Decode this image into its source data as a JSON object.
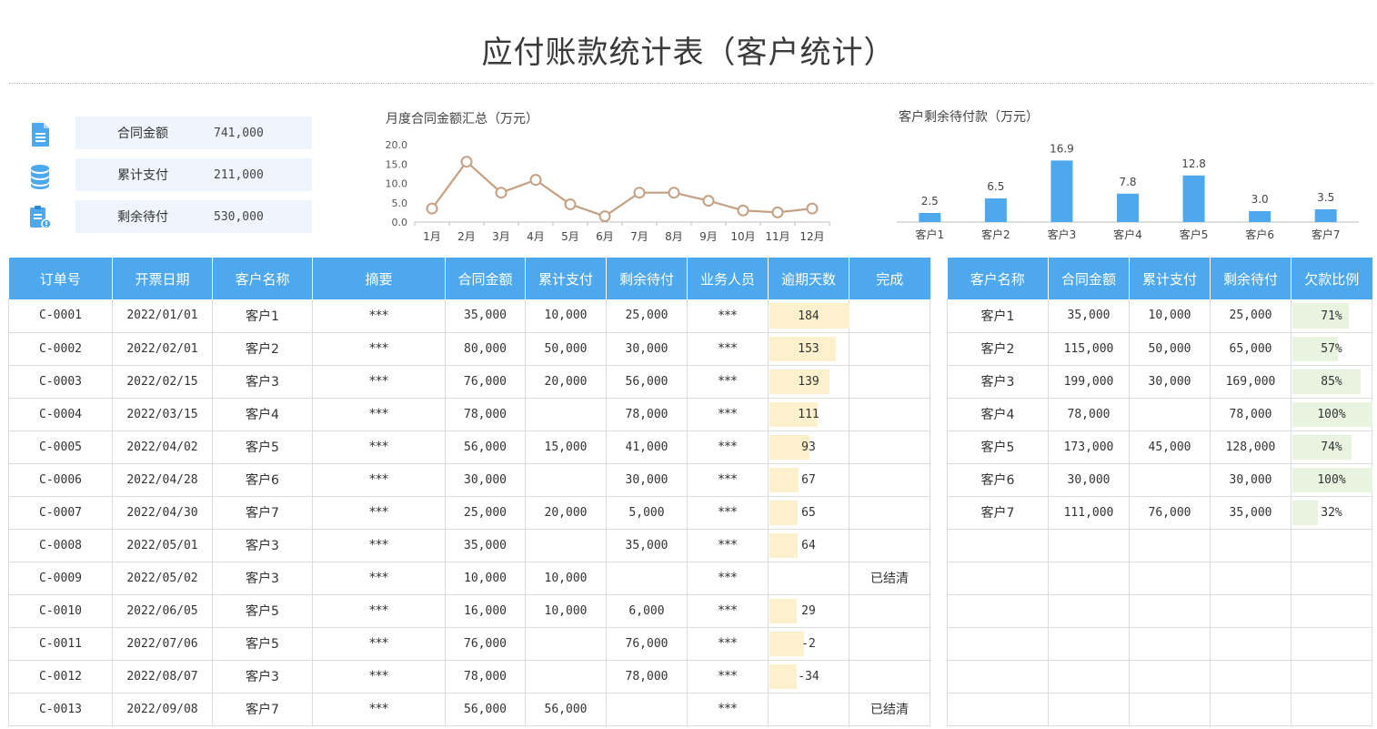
{
  "title": "应付账款统计表（客户统计）",
  "summary": [
    {
      "label": "合同金额",
      "value": "741,000",
      "icon": "document-icon"
    },
    {
      "label": "累计支付",
      "value": "211,000",
      "icon": "database-icon"
    },
    {
      "label": "剩余待付",
      "value": "530,000",
      "icon": "clipboard-alert-icon"
    }
  ],
  "chart_data": [
    {
      "type": "line",
      "title": "月度合同金额汇总（万元）",
      "categories": [
        "1月",
        "2月",
        "3月",
        "4月",
        "5月",
        "6月",
        "7月",
        "8月",
        "9月",
        "10月",
        "11月",
        "12月"
      ],
      "values": [
        3.5,
        15.6,
        7.6,
        10.9,
        4.6,
        1.5,
        7.6,
        7.6,
        5.5,
        3.0,
        2.5,
        3.5
      ],
      "ylim": [
        0,
        20
      ],
      "yticks": [
        "0.0",
        "5.0",
        "10.0",
        "15.0",
        "20.0"
      ],
      "color": "#c4a184",
      "grid": false
    },
    {
      "type": "bar",
      "title": "客户剩余待付款（万元）",
      "categories": [
        "客户1",
        "客户2",
        "客户3",
        "客户4",
        "客户5",
        "客户6",
        "客户7"
      ],
      "values": [
        2.5,
        6.5,
        16.9,
        7.8,
        12.8,
        3.0,
        3.5
      ],
      "labels": [
        "2.5",
        "6.5",
        "16.9",
        "7.8",
        "12.8",
        "3.0",
        "3.5"
      ],
      "ylim": [
        0,
        17
      ],
      "color": "#4ea8ee",
      "grid": false
    }
  ],
  "orders": {
    "headers": [
      "订单号",
      "开票日期",
      "客户名称",
      "摘要",
      "合同金额",
      "累计支付",
      "剩余待付",
      "业务人员",
      "逾期天数",
      "完成"
    ],
    "overdue_max": 184,
    "rows": [
      {
        "id": "C-0001",
        "date": "2022/01/01",
        "customer": "客户1",
        "summary": "***",
        "amount": "35,000",
        "paid": "10,000",
        "remaining": "25,000",
        "staff": "***",
        "overdue": 184,
        "done": ""
      },
      {
        "id": "C-0002",
        "date": "2022/02/01",
        "customer": "客户2",
        "summary": "***",
        "amount": "80,000",
        "paid": "50,000",
        "remaining": "30,000",
        "staff": "***",
        "overdue": 153,
        "done": ""
      },
      {
        "id": "C-0003",
        "date": "2022/02/15",
        "customer": "客户3",
        "summary": "***",
        "amount": "76,000",
        "paid": "20,000",
        "remaining": "56,000",
        "staff": "***",
        "overdue": 139,
        "done": ""
      },
      {
        "id": "C-0004",
        "date": "2022/03/15",
        "customer": "客户4",
        "summary": "***",
        "amount": "78,000",
        "paid": "",
        "remaining": "78,000",
        "staff": "***",
        "overdue": 111,
        "done": ""
      },
      {
        "id": "C-0005",
        "date": "2022/04/02",
        "customer": "客户5",
        "summary": "***",
        "amount": "56,000",
        "paid": "15,000",
        "remaining": "41,000",
        "staff": "***",
        "overdue": 93,
        "done": ""
      },
      {
        "id": "C-0006",
        "date": "2022/04/28",
        "customer": "客户6",
        "summary": "***",
        "amount": "30,000",
        "paid": "",
        "remaining": "30,000",
        "staff": "***",
        "overdue": 67,
        "done": ""
      },
      {
        "id": "C-0007",
        "date": "2022/04/30",
        "customer": "客户7",
        "summary": "***",
        "amount": "25,000",
        "paid": "20,000",
        "remaining": "5,000",
        "staff": "***",
        "overdue": 65,
        "done": ""
      },
      {
        "id": "C-0008",
        "date": "2022/05/01",
        "customer": "客户3",
        "summary": "***",
        "amount": "35,000",
        "paid": "",
        "remaining": "35,000",
        "staff": "***",
        "overdue": 64,
        "done": ""
      },
      {
        "id": "C-0009",
        "date": "2022/05/02",
        "customer": "客户3",
        "summary": "***",
        "amount": "10,000",
        "paid": "10,000",
        "remaining": "",
        "staff": "***",
        "overdue": null,
        "done": "已结清"
      },
      {
        "id": "C-0010",
        "date": "2022/06/05",
        "customer": "客户5",
        "summary": "***",
        "amount": "16,000",
        "paid": "10,000",
        "remaining": "6,000",
        "staff": "***",
        "overdue": 29,
        "done": ""
      },
      {
        "id": "C-0011",
        "date": "2022/07/06",
        "customer": "客户5",
        "summary": "***",
        "amount": "76,000",
        "paid": "",
        "remaining": "76,000",
        "staff": "***",
        "overdue": -2,
        "done": ""
      },
      {
        "id": "C-0012",
        "date": "2022/08/07",
        "customer": "客户3",
        "summary": "***",
        "amount": "78,000",
        "paid": "",
        "remaining": "78,000",
        "staff": "***",
        "overdue": -34,
        "done": ""
      },
      {
        "id": "C-0013",
        "date": "2022/09/08",
        "customer": "客户7",
        "summary": "***",
        "amount": "56,000",
        "paid": "56,000",
        "remaining": "",
        "staff": "***",
        "overdue": null,
        "done": "已结清"
      }
    ]
  },
  "customers": {
    "headers": [
      "客户名称",
      "合同金额",
      "累计支付",
      "剩余待付",
      "欠款比例"
    ],
    "rows": [
      {
        "name": "客户1",
        "amount": "35,000",
        "paid": "10,000",
        "remaining": "25,000",
        "ratio": "71%",
        "ratio_value": 0.71
      },
      {
        "name": "客户2",
        "amount": "115,000",
        "paid": "50,000",
        "remaining": "65,000",
        "ratio": "57%",
        "ratio_value": 0.57
      },
      {
        "name": "客户3",
        "amount": "199,000",
        "paid": "30,000",
        "remaining": "169,000",
        "ratio": "85%",
        "ratio_value": 0.85
      },
      {
        "name": "客户4",
        "amount": "78,000",
        "paid": "",
        "remaining": "78,000",
        "ratio": "100%",
        "ratio_value": 1.0
      },
      {
        "name": "客户5",
        "amount": "173,000",
        "paid": "45,000",
        "remaining": "128,000",
        "ratio": "74%",
        "ratio_value": 0.74
      },
      {
        "name": "客户6",
        "amount": "30,000",
        "paid": "",
        "remaining": "30,000",
        "ratio": "100%",
        "ratio_value": 1.0
      },
      {
        "name": "客户7",
        "amount": "111,000",
        "paid": "76,000",
        "remaining": "35,000",
        "ratio": "32%",
        "ratio_value": 0.32
      }
    ],
    "empty_rows": 6
  },
  "colors": {
    "header_bg": "#4ea8ee",
    "databar": "#fdf0cd",
    "ratiobar": "#e8f3e0",
    "cleared_text": "#8b1a1a",
    "line": "#c4a184",
    "bar": "#4ea8ee"
  }
}
